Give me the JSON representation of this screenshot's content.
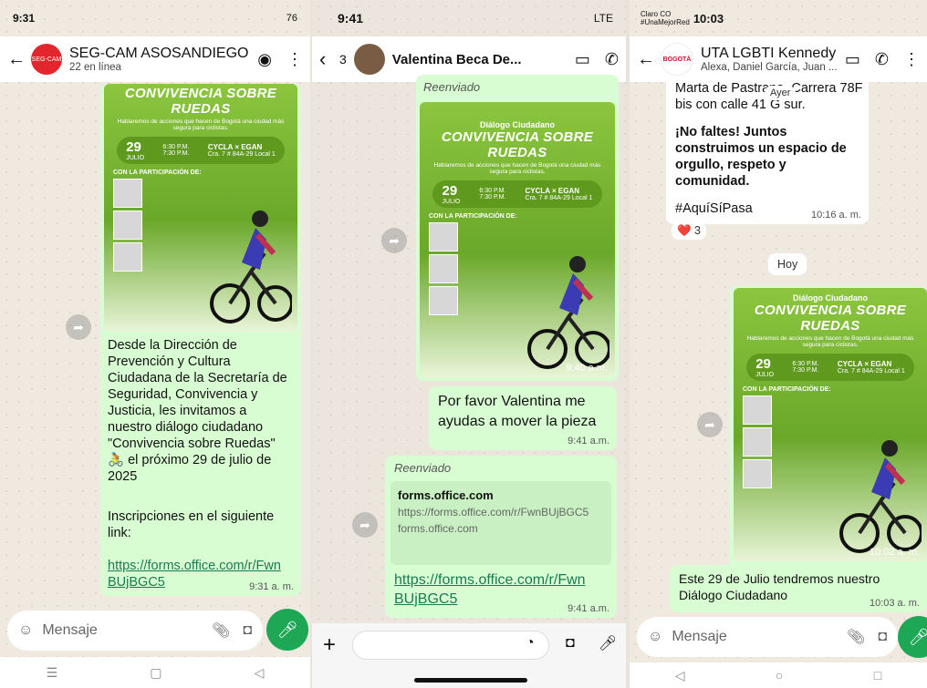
{
  "p1": {
    "status_time": "9:31",
    "status_right": "76",
    "chat_title": "SEG-CAM ASOSANDIEGO",
    "chat_sub": "22 en línea",
    "avatar_text": "SEG-CAM",
    "poster": {
      "header": "CONVIVENCIA SOBRE RUEDAS",
      "desc": "Hablaremos de acciones que hacen de Bogotá una ciudad más segura para ciclistas.",
      "day": "29",
      "month": "JULIO",
      "time1": "6:30 P.M.",
      "time2": "7:30 P.M.",
      "venue": "CYCLA × EGAN",
      "addr": "Cra. 7 # 84A-29 Local 1",
      "part": "CON LA PARTICIPACIÓN DE:"
    },
    "message": "Desde la Dirección de Prevención y Cultura Ciudadana de la Secretaría de Seguridad, Convivencia y Justicia, les invitamos a nuestro diálogo ciudadano \"Convivencia sobre Ruedas\" 🚴 el próximo 29 de julio de 2025",
    "message2": "Inscripciones en el siguiente link:",
    "link": "https://forms.office.com/r/FwnBUjBGC5",
    "time": "9:31 a. m.",
    "input_placeholder": "Mensaje"
  },
  "p2": {
    "status_time": "9:41",
    "status_right": "LTE",
    "back_count": "3",
    "chat_title": "Valentina Beca De...",
    "forwarded": "Reenviado",
    "poster": {
      "kicker": "Diálogo Ciudadano",
      "header": "CONVIVENCIA SOBRE RUEDAS",
      "desc": "Hablaremos de acciones que hacen de Bogotá una ciudad más segura para ciclistas.",
      "day": "29",
      "month": "JULIO",
      "time1": "6:30 P.M.",
      "time2": "7:30 P.M.",
      "venue": "CYCLA × EGAN",
      "addr": "Cra. 7 # 84A-29 Local 1",
      "part": "CON LA PARTICIPACIÓN DE:"
    },
    "poster_time": "9:40 a.m.",
    "msg": "Por favor Valentina me ayudas a mover la pieza",
    "msg_time": "9:41 a.m.",
    "forwarded2": "Reenviado",
    "link_card_title": "forms.office.com",
    "link_card_url": "https://forms.office.com/r/FwnBUjBGC5",
    "link_card_host": "forms.office.com",
    "link": "https://forms.office.com/r/FwnBUjBGC5",
    "link_time": "9:41 a.m."
  },
  "p3": {
    "status_carrier": "Claro CO",
    "status_tag": "#UnaMejorRed",
    "status_time": "10:03",
    "chat_title": "UTA LGBTI Kennedy",
    "chat_sub": "Alexa, Daniel García, Juan ...",
    "avatar_text": "BOGOTÁ",
    "msg_top": "Marta de Pastrana, Carrera 78F bis con calle 41 G sur.",
    "ayer": "Ayer",
    "msg_bold": "¡No faltes! Juntos construimos un espacio de orgullo, respeto y comunidad.",
    "hashtag": "#AquíSíPasa",
    "msg_time": "10:16 a. m.",
    "reaction": "❤️ 3",
    "hoy": "Hoy",
    "poster": {
      "kicker": "Diálogo Ciudadano",
      "header": "CONVIVENCIA SOBRE RUEDAS",
      "desc": "Hablaremos de acciones que hacen de Bogotá una ciudad más segura para ciclistas.",
      "day": "29",
      "month": "JULIO",
      "time1": "6:30 P.M.",
      "time2": "7:30 P.M.",
      "venue": "CYCLA × EGAN",
      "addr": "Cra. 7 # 84A-29 Local 1",
      "part": "CON LA PARTICIPACIÓN DE:"
    },
    "poster_time": "10:02 a. m.",
    "caption": "Este 29 de Julio tendremos nuestro Diálogo Ciudadano",
    "caption_time": "10:03 a. m.",
    "input_placeholder": "Mensaje"
  },
  "colors": {
    "bubble_out": "#d9fdd3",
    "accent": "#1ea855",
    "link": "#1a7a52"
  }
}
